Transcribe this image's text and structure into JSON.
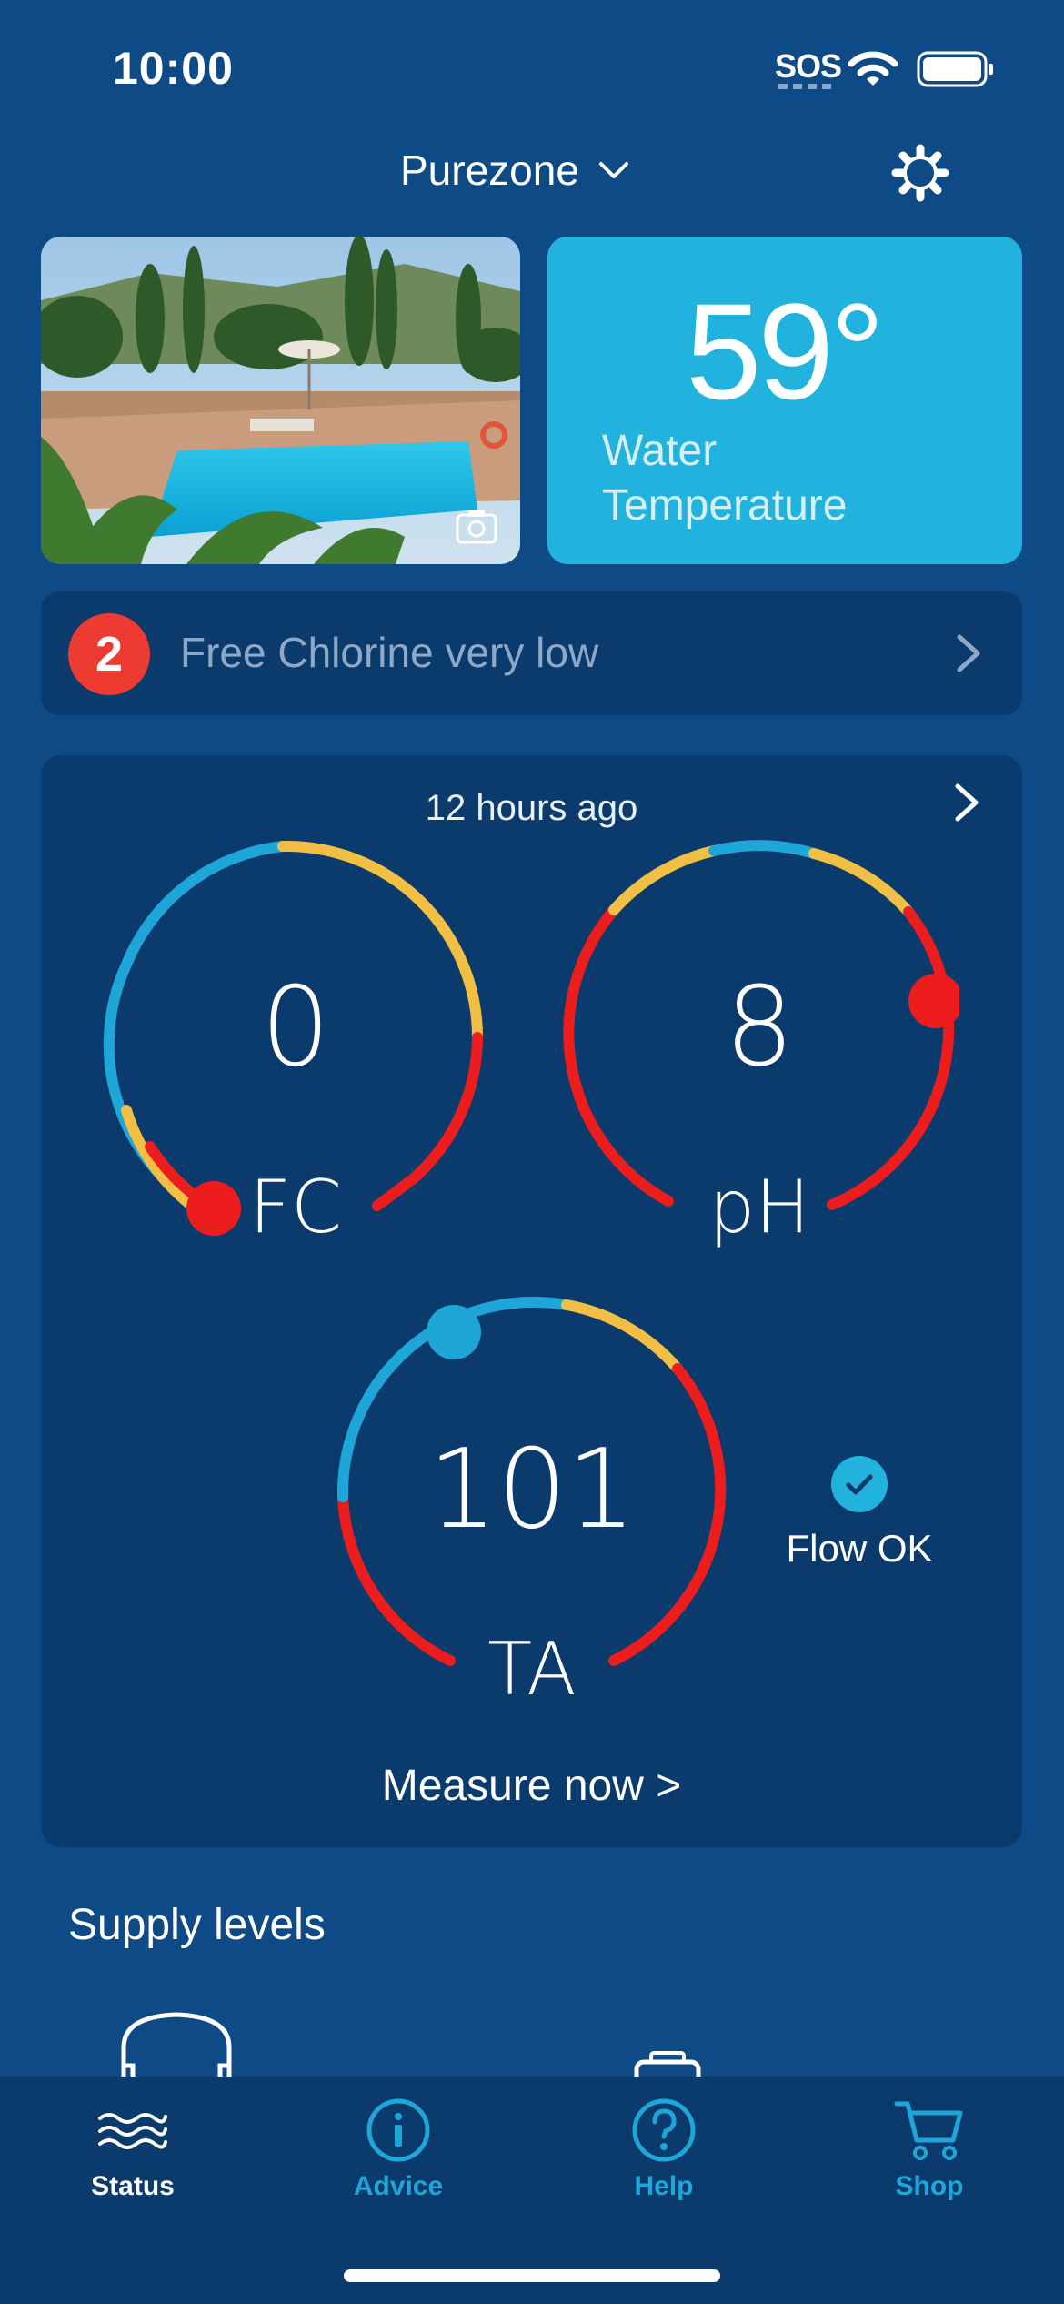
{
  "status_bar": {
    "time": "10:00",
    "sos": "SOS"
  },
  "header": {
    "site_name": "Purezone"
  },
  "water": {
    "temperature": "59°",
    "label": "Water Temperature"
  },
  "alert": {
    "count": "2",
    "message": "Free Chlorine very low"
  },
  "readings": {
    "updated": "12 hours ago",
    "gauges": [
      {
        "label": "FC",
        "value": "0"
      },
      {
        "label": "pH",
        "value": "8"
      },
      {
        "label": "TA",
        "value": "101"
      }
    ],
    "flow_status": "Flow OK",
    "measure_link": "Measure now >"
  },
  "supply": {
    "title": "Supply levels"
  },
  "tabs": [
    {
      "label": "Status",
      "icon": "waves-icon",
      "active": true
    },
    {
      "label": "Advice",
      "icon": "info-icon",
      "active": false
    },
    {
      "label": "Help",
      "icon": "help-icon",
      "active": false
    },
    {
      "label": "Shop",
      "icon": "cart-icon",
      "active": false
    }
  ],
  "colors": {
    "background": "#0e4a86",
    "card": "#0b3b6c",
    "accent": "#21b3de",
    "warning": "#f2bf45",
    "danger": "#ee1d1d"
  }
}
